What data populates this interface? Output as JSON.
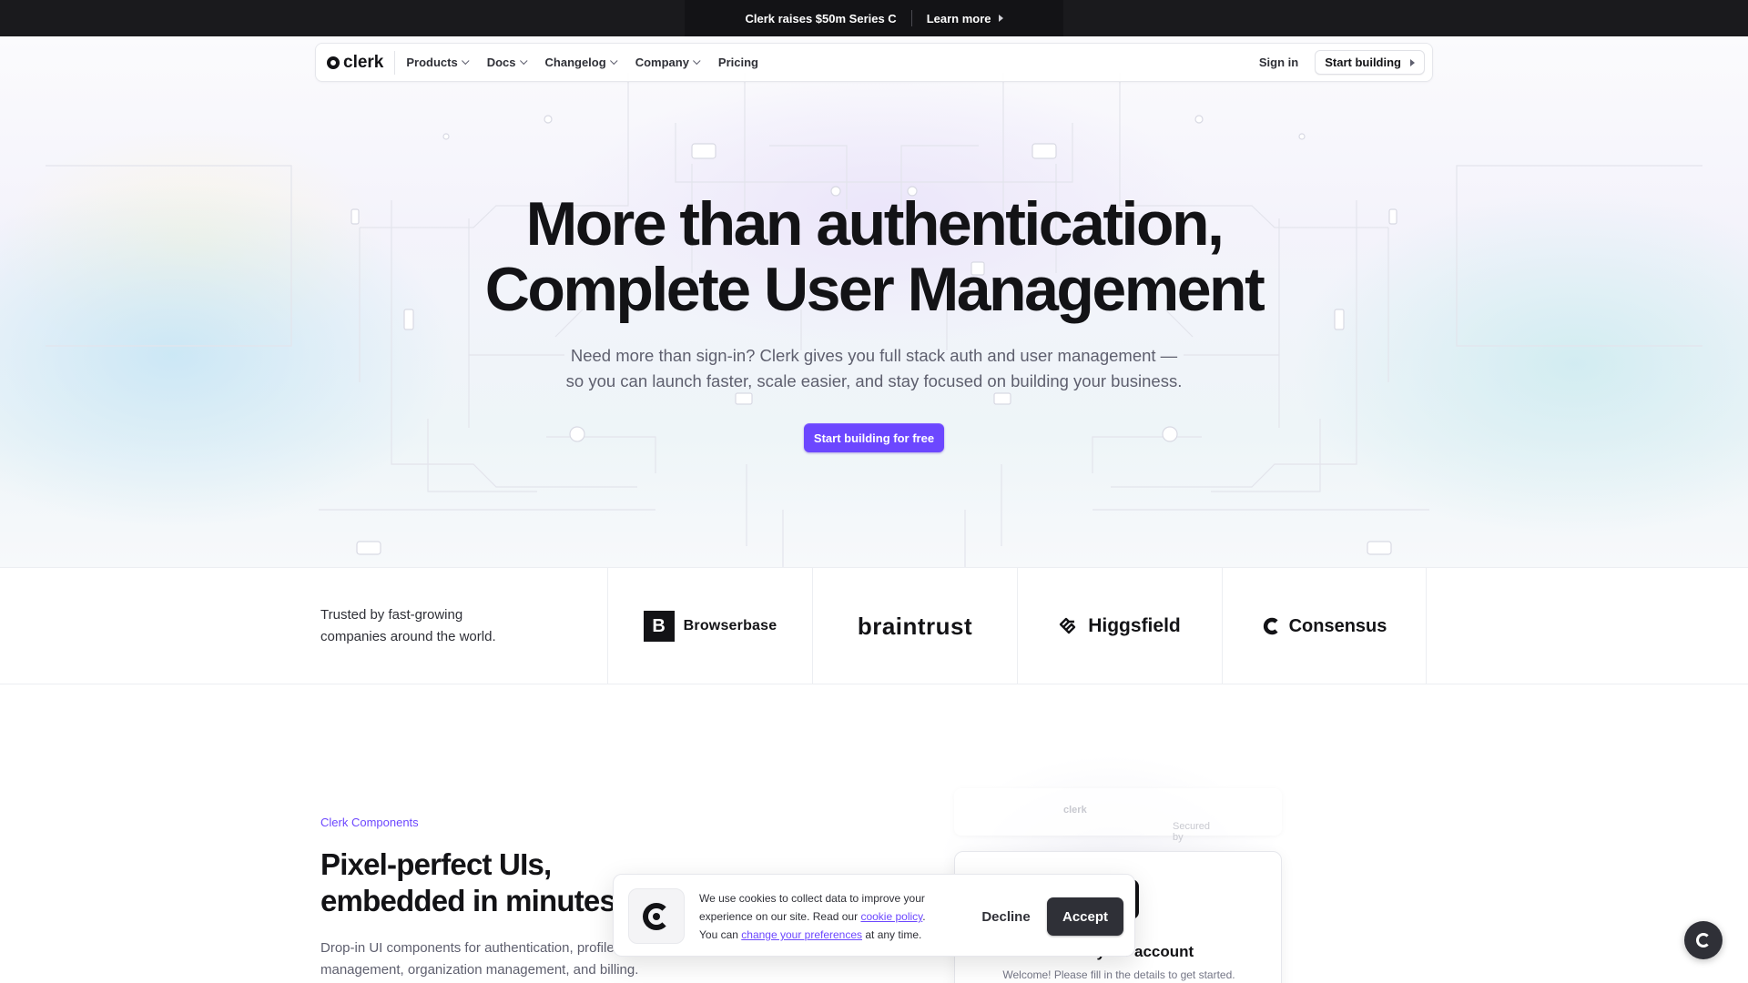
{
  "announcement": {
    "text": "Clerk raises $50m Series C",
    "link": "Learn more"
  },
  "nav": {
    "logo": "clerk",
    "items": [
      {
        "label": "Products",
        "has_dropdown": true
      },
      {
        "label": "Docs",
        "has_dropdown": true
      },
      {
        "label": "Changelog",
        "has_dropdown": true
      },
      {
        "label": "Company",
        "has_dropdown": true
      },
      {
        "label": "Pricing",
        "has_dropdown": false
      }
    ],
    "sign_in": "Sign in",
    "start_building": "Start building"
  },
  "hero": {
    "title_line1": "More than authentication,",
    "title_line2": "Complete User Management",
    "subtitle_line1": "Need more than sign-in? Clerk gives you full stack auth and user management —",
    "subtitle_line2": "so you can launch faster, scale easier, and stay focused on building your business.",
    "cta": "Start building for free",
    "accent_color": "#6c47ff"
  },
  "trusted": {
    "text_line1": "Trusted by fast-growing",
    "text_line2": "companies around the world.",
    "logos": [
      {
        "mark": "B",
        "name": "Browserbase"
      },
      {
        "name": "braintrust"
      },
      {
        "name": "Higgsfield"
      },
      {
        "name": "Consensus"
      }
    ]
  },
  "components": {
    "eyebrow": "Clerk Components",
    "title_line1": "Pixel-perfect UIs,",
    "title_line2": "embedded in minutes",
    "desc_line1": "Drop-in UI components for authentication, profile",
    "desc_line2": "management, organization management, and billing."
  },
  "preview": {
    "secured_by": "Secured by",
    "brand": "clerk",
    "card_title": "Create your account",
    "card_subtitle": "Welcome! Please fill in the details to get started."
  },
  "cookie": {
    "text1": "We use cookies to collect data to improve your experience on our site. Read our ",
    "link1": "cookie policy",
    "text2": ". You can ",
    "link2": "change your preferences",
    "text3": " at any time.",
    "decline": "Decline",
    "accept": "Accept"
  }
}
